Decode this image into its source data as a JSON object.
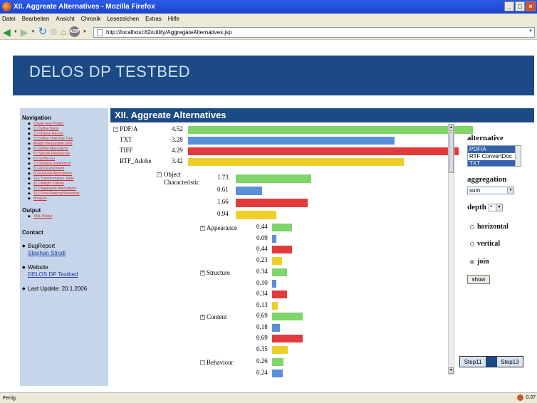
{
  "browser": {
    "window_title": "XII. Aggreate Alternatives - Mozilla Firefox",
    "menu": [
      "Datei",
      "Bearbeiten",
      "Ansicht",
      "Chronik",
      "Lesezeichen",
      "Extras",
      "Hilfe"
    ],
    "url": "http://localhost:82/utility/AggregateAlternatives.jsp",
    "adblock_label": "ABP",
    "status": "Fertig",
    "status_right": "0.37"
  },
  "page": {
    "banner_title": "DELOS DP TESTBED",
    "main_title": "XII. Aggreate Alternatives"
  },
  "sidebar": {
    "navigation_heading": "Navigation",
    "nav_items": [
      "Create new Project",
      "1.) Define Basis",
      "2.) Choose Record",
      "3.) Define Objective Tree",
      "Assign measurable units",
      "4.) Define Alternatives",
      "5.) Specify Ressources",
      "6.) Go/No-Go",
      "7.) Develop Experiment",
      "8.) Run Experiment",
      "9.) Evaluate Alternatives",
      "10.) Transformation Table",
      "11.) Weight Criteria",
      "12.) Aggregate Alternatives",
      "13.) Final Ranking/Sensitivity",
      "Analysis"
    ],
    "output_heading": "Output",
    "output_items": [
      "XML Output"
    ],
    "contact_heading": "Contact",
    "bugreport_label": "BugReport",
    "bugreport_link": "Stephan Strodl",
    "website_label": "Website",
    "website_link": "DELOS DP Testbed",
    "last_update": "Last Update: 20.1.2006"
  },
  "chart_data": {
    "type": "bar",
    "series_colors": {
      "PDF/A": "#7fd46a",
      "TXT": "#5b8fd8",
      "TIFF": "#e23b3b",
      "RTF_Adobe": "#eecf2a"
    },
    "series": [
      "PDF/A",
      "TXT",
      "TIFF",
      "RTF_Adobe"
    ],
    "root": {
      "values": [
        4.52,
        3.28,
        4.29,
        3.42
      ]
    },
    "nodes": [
      {
        "name": "Object\nCharacteristic",
        "toggle": "−",
        "values": [
          1.73,
          0.61,
          1.66,
          0.94
        ]
      },
      {
        "name": "Appearance",
        "toggle": "+",
        "values": [
          0.44,
          0.09,
          0.44,
          0.23
        ]
      },
      {
        "name": "Structure",
        "toggle": "+",
        "values": [
          0.34,
          0.1,
          0.34,
          0.13
        ]
      },
      {
        "name": "Content",
        "toggle": "+",
        "values": [
          0.69,
          0.18,
          0.69,
          0.35
        ]
      },
      {
        "name": "Behaviour",
        "toggle": "−",
        "values": [
          0.26,
          0.24
        ]
      }
    ],
    "value_labels": {
      "root": [
        "4.52",
        "3.28",
        "4.29",
        "3.42"
      ],
      "nodes": [
        [
          "1.73",
          "0.61",
          "1.66",
          "0.94"
        ],
        [
          "0.44",
          "0.09",
          "0.44",
          "0.23"
        ],
        [
          "0.34",
          "0.10",
          "0.34",
          "0.13"
        ],
        [
          "0.69",
          "0.18",
          "0.69",
          "0.35"
        ],
        [
          "0.26",
          "0.24"
        ]
      ]
    },
    "root_toggle": "−"
  },
  "controls": {
    "alternative_label": "alternative",
    "alternatives": [
      "PDF/A",
      "RTF ConvertDoc",
      "TXT"
    ],
    "selected_alternatives": [
      "PDF/A",
      "TXT"
    ],
    "aggregation_label": "aggregation",
    "aggregation_value": "sum",
    "depth_label": "depth",
    "depth_value": "*",
    "layout_options": [
      "horizontal",
      "vertical",
      "join"
    ],
    "selected_layout": "join",
    "show_button": "show",
    "step_prev": "Step11",
    "step_next": "Step13"
  }
}
